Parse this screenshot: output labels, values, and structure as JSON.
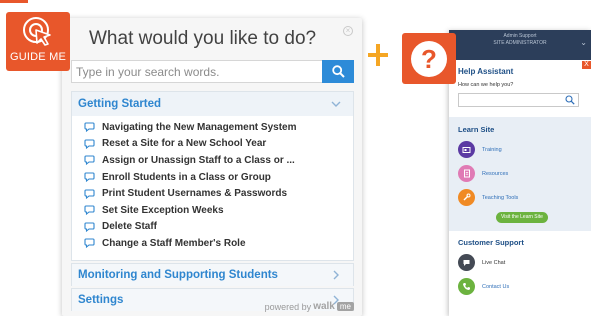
{
  "guide_badge": {
    "label": "GUIDE ME",
    "icon": "cursor-click-icon",
    "color": "#e8572b"
  },
  "walkme": {
    "title": "What would you like to do?",
    "search_placeholder": "Type in your search words.",
    "search_icon": "search-icon",
    "sections": [
      {
        "label": "Getting Started",
        "expanded": true,
        "items": [
          "Navigating the New Management System",
          "Reset a Site for a New School Year",
          "Assign or Unassign Staff to a Class or ...",
          "Enroll Students in a Class or Group",
          "Print Student Usernames & Passwords",
          "Set Site Exception Weeks",
          "Delete Staff",
          "Change a Staff Member's Role"
        ]
      },
      {
        "label": "Monitoring and Supporting Students",
        "expanded": false
      },
      {
        "label": "Settings",
        "expanded": false
      }
    ],
    "powered_by": "powered by",
    "brand": "walk",
    "brand_badge": "me"
  },
  "plus_color": "#f5a623",
  "help_badge": {
    "icon": "question-mark-icon",
    "glyph": "?"
  },
  "help_assistant": {
    "topbar_line1": "Admin Support",
    "topbar_line2": "SITE ADMINISTRATOR",
    "close_label": "X",
    "title": "Help Assistant",
    "prompt": "How can we help you?",
    "learn_site": {
      "title": "Learn Site",
      "items": [
        {
          "label": "Training",
          "icon": "training-icon",
          "color": "#5b3aa3"
        },
        {
          "label": "Resources",
          "icon": "resources-icon",
          "color": "#e07bb5"
        },
        {
          "label": "Teaching Tools",
          "icon": "teaching-tools-icon",
          "color": "#f08a24"
        }
      ],
      "button": "Visit the Learn Site"
    },
    "customer_support": {
      "title": "Customer Support",
      "items": [
        {
          "label": "Live Chat",
          "icon": "chat-icon",
          "color": "#444a55"
        },
        {
          "label": "Contact Us",
          "icon": "phone-icon",
          "color": "#6cb33f"
        }
      ]
    }
  }
}
